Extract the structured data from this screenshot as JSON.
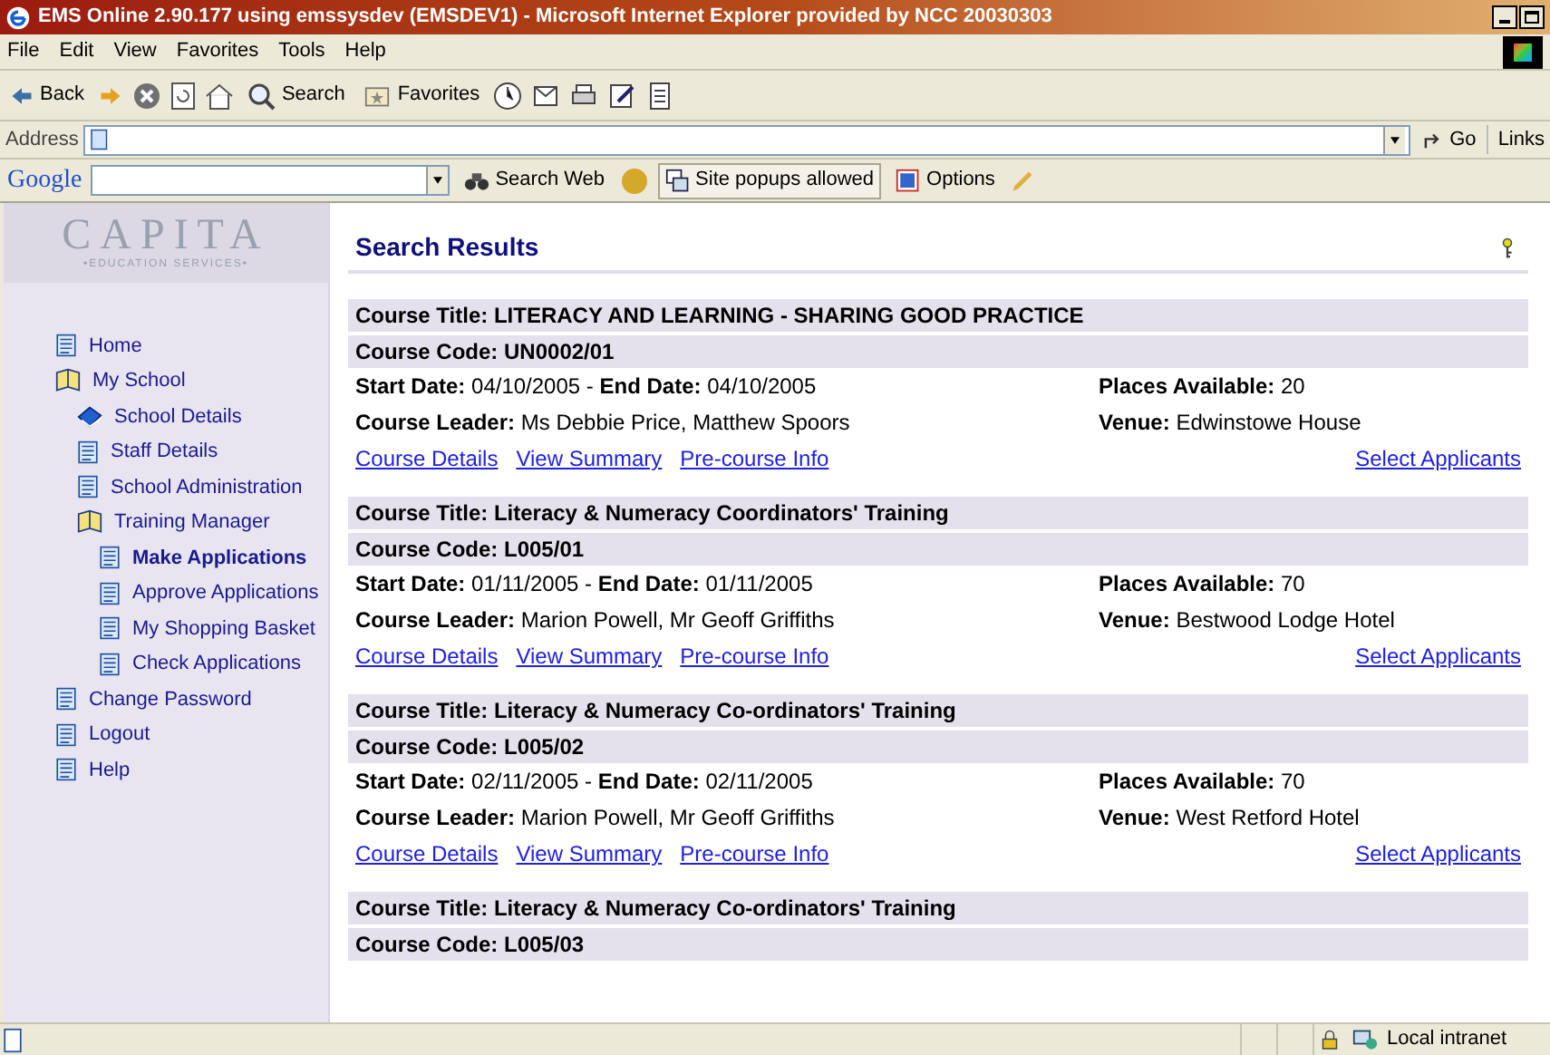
{
  "window": {
    "title": "EMS Online 2.90.177 using emssysdev (EMSDEV1) - Microsoft Internet Explorer provided by NCC 20030303"
  },
  "menu": [
    "File",
    "Edit",
    "View",
    "Favorites",
    "Tools",
    "Help"
  ],
  "toolbar": {
    "back": "Back",
    "search": "Search",
    "favorites": "Favorites"
  },
  "address_bar": {
    "label": "Address",
    "go": "Go",
    "links": "Links"
  },
  "google_bar": {
    "logo": "Google",
    "search_web": "Search Web",
    "popups": "Site popups allowed",
    "options": "Options"
  },
  "sidebar": {
    "logo": "CAPITA",
    "logo_subtitle": "•EDUCATION SERVICES•",
    "items": [
      {
        "label": "Home",
        "kind": "page",
        "selected": false
      },
      {
        "label": "My School",
        "kind": "folder",
        "selected": false,
        "children": [
          {
            "label": "School Details",
            "kind": "book",
            "selected": false
          },
          {
            "label": "Staff Details",
            "kind": "page",
            "selected": false
          },
          {
            "label": "School Administration",
            "kind": "page",
            "selected": false
          },
          {
            "label": "Training Manager",
            "kind": "folder",
            "selected": false,
            "children": [
              {
                "label": "Make Applications",
                "kind": "page",
                "selected": true
              },
              {
                "label": "Approve Applications",
                "kind": "page",
                "selected": false
              },
              {
                "label": "My Shopping Basket",
                "kind": "page",
                "selected": false
              },
              {
                "label": "Check Applications",
                "kind": "page",
                "selected": false
              }
            ]
          }
        ]
      },
      {
        "label": "Change Password",
        "kind": "page",
        "selected": false
      },
      {
        "label": "Logout",
        "kind": "page",
        "selected": false
      },
      {
        "label": "Help",
        "kind": "page",
        "selected": false
      }
    ]
  },
  "page": {
    "title": "Search Results"
  },
  "courses": [
    {
      "title": "Course Title: LITERACY AND LEARNING - SHARING GOOD PRACTICE",
      "code": "Course Code: UN0002/01",
      "dates": "**Start Date:** 04/10/2005 - **End Date:** 04/10/2005",
      "places": "**Places Available:** 20",
      "leader": "**Course Leader:** Ms Debbie Price, Matthew Spoors",
      "venue": "**Venue:** Edwinstowe House",
      "links": [
        "Course Details",
        "View Summary",
        "Pre-course Info"
      ],
      "action": "Select Applicants"
    },
    {
      "title": "Course Title: Literacy & Numeracy Coordinators' Training",
      "code": "Course Code: L005/01",
      "dates": "**Start Date:** 01/11/2005 - **End Date:** 01/11/2005",
      "places": "**Places Available:** 70",
      "leader": "**Course Leader:** Marion Powell, Mr Geoff Griffiths",
      "venue": "**Venue:** Bestwood Lodge Hotel",
      "links": [
        "Course Details",
        "View Summary",
        "Pre-course Info"
      ],
      "action": "Select Applicants"
    },
    {
      "title": "Course Title: Literacy & Numeracy Co-ordinators' Training",
      "code": "Course Code: L005/02",
      "dates": "**Start Date:** 02/11/2005 - **End Date:** 02/11/2005",
      "places": "**Places Available:** 70",
      "leader": "**Course Leader:** Marion Powell, Mr Geoff Griffiths",
      "venue": "**Venue:** West Retford Hotel",
      "links": [
        "Course Details",
        "View Summary",
        "Pre-course Info"
      ],
      "action": "Select Applicants"
    },
    {
      "title": "Course Title: Literacy & Numeracy Co-ordinators' Training",
      "code": "Course Code: L005/03"
    }
  ],
  "status_bar": {
    "zone": "Local intranet"
  }
}
